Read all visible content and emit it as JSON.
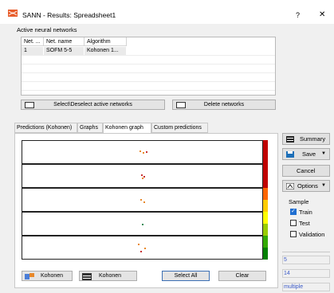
{
  "window": {
    "title": "SANN - Results: Spreadsheet1",
    "help": "?",
    "close": "✕"
  },
  "networks": {
    "group_label": "Active neural networks",
    "columns": [
      "Net. ...",
      "Net. name",
      "Algorithm"
    ],
    "rows": [
      {
        "id": "1",
        "name": "SOFM 5-5",
        "algorithm": "Kohonen 1..."
      }
    ],
    "select_button": "Select\\Deselect active networks",
    "delete_button": "Delete networks"
  },
  "tabs": [
    "Predictions (Kohonen)",
    "Graphs",
    "Kohonen graph",
    "Custom predictions"
  ],
  "active_tab": "Kohonen graph",
  "graph": {
    "scale_colors": [
      "#c00000",
      "#ff6600",
      "#ffcc00",
      "#ffff00",
      "#99cc00",
      "#33aa00",
      "#008000"
    ]
  },
  "bottom_buttons": {
    "kohonen1": "Kohonen",
    "kohonen2": "Kohonen",
    "select_all": "Select All",
    "clear": "Clear"
  },
  "side": {
    "summary": "Summary",
    "save": "Save",
    "cancel": "Cancel",
    "options": "Options",
    "sample_label": "Sample",
    "train": "Train",
    "test": "Test",
    "validation": "Validation",
    "train_checked": true,
    "test_checked": false,
    "validation_checked": false,
    "field1": "5",
    "field2": "14",
    "field3": "multiple"
  },
  "colors": {
    "accent": "#1f6fd1",
    "field_text": "#3a59c7",
    "dot_orange": "#e8882a",
    "dot_red": "#c83232",
    "dot_green": "#2e8b57"
  }
}
